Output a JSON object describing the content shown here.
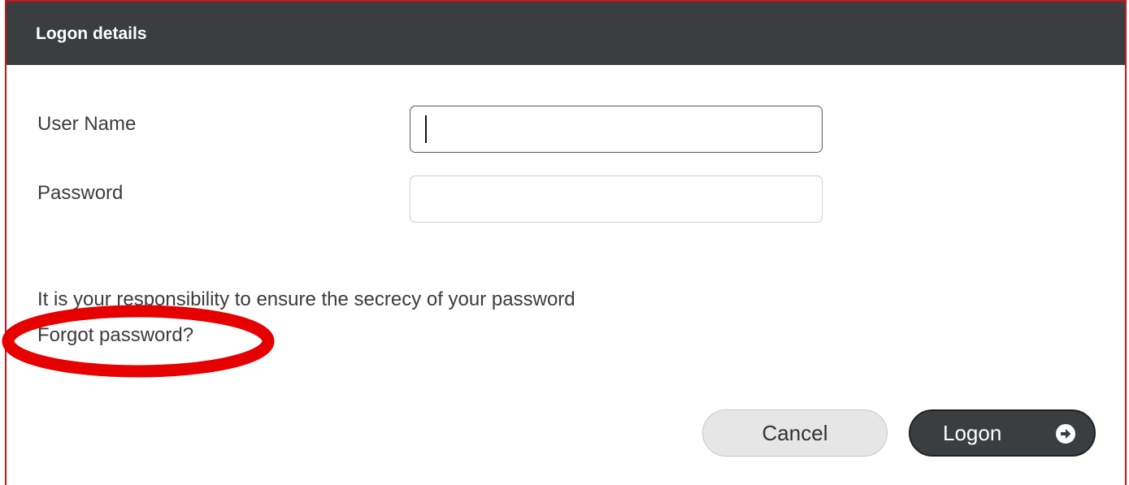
{
  "header": {
    "title": "Logon details"
  },
  "form": {
    "username_label": "User Name",
    "username_value": "",
    "password_label": "Password",
    "password_value": ""
  },
  "notice": "It is your responsibility to ensure the secrecy of your password",
  "forgot_link": "Forgot password?",
  "buttons": {
    "cancel_label": "Cancel",
    "logon_label": "Logon",
    "logon_icon": "arrow-right-circle-icon"
  },
  "colors": {
    "header_bg": "#3a3e41",
    "border_accent": "#c8161d",
    "highlight_ring": "#e60000",
    "cancel_bg": "#e6e6e6",
    "logon_bg": "#3a3e41"
  }
}
